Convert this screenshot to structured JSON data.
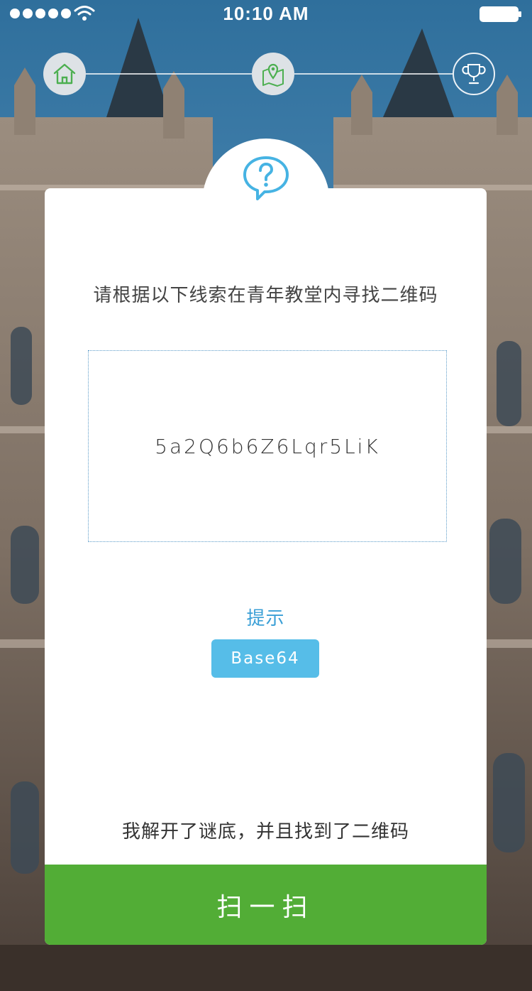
{
  "status_bar": {
    "time": "10:10 AM",
    "icons": [
      "signal-dots-icon",
      "wifi-icon",
      "battery-icon"
    ]
  },
  "stepper": {
    "steps": [
      {
        "icon": "home-icon",
        "state": "done"
      },
      {
        "icon": "map-pin-icon",
        "state": "current"
      },
      {
        "icon": "trophy-icon",
        "state": "pending"
      }
    ]
  },
  "card": {
    "icon": "question-bubble-icon",
    "instruction": "请根据以下线索在青年教堂内寻找二维码",
    "clue": "5a2Q6b6Z6Lqr5LiK",
    "hint_title": "提示",
    "hint_value": "Base64",
    "confirm_text": "我解开了谜底，并且找到了二维码",
    "scan_label": "扫一扫"
  },
  "colors": {
    "accent_blue": "#56bde8",
    "hint_blue": "#3a9fd6",
    "button_green": "#52ad36",
    "card_bg": "#ffffff"
  }
}
